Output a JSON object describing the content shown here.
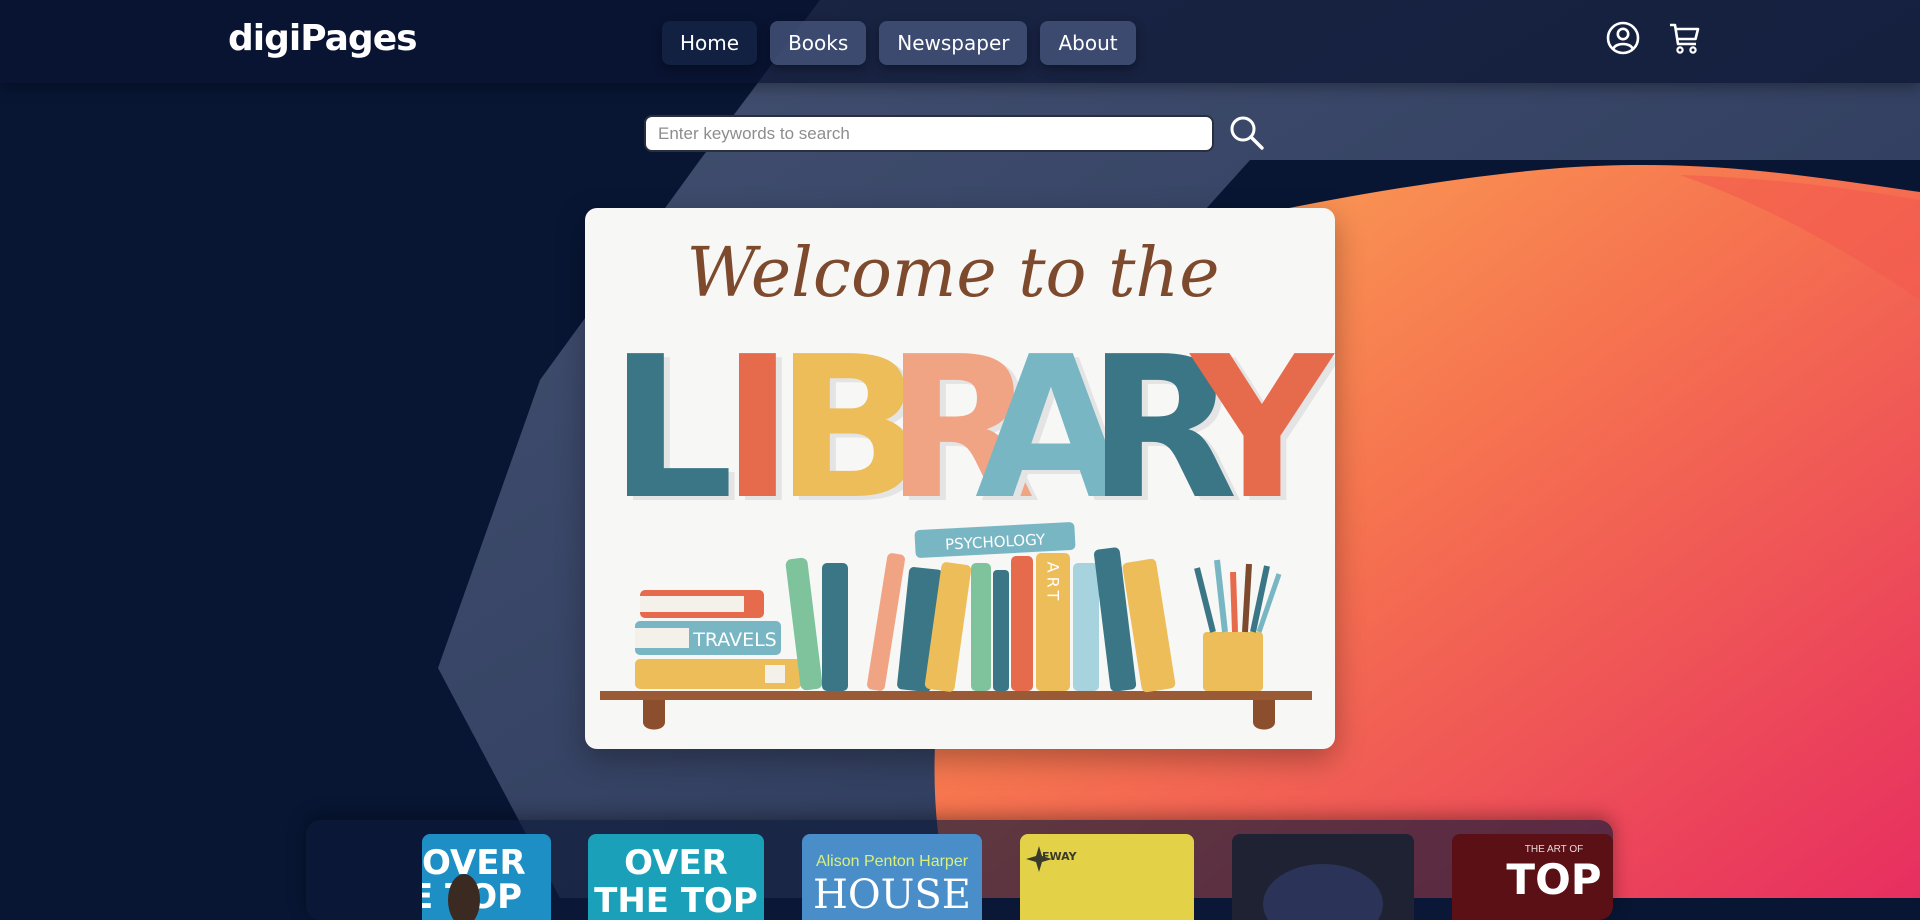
{
  "brand": {
    "name": "digiPages"
  },
  "nav": {
    "items": [
      {
        "label": "Home",
        "active": true
      },
      {
        "label": "Books",
        "active": false
      },
      {
        "label": "Newspaper",
        "active": false
      },
      {
        "label": "About",
        "active": false
      }
    ],
    "icons": [
      "user-icon",
      "cart-icon"
    ]
  },
  "search": {
    "placeholder": "Enter keywords to search",
    "value": ""
  },
  "hero": {
    "heading_script": "Welcome to the",
    "heading_letters": [
      "L",
      "I",
      "B",
      "R",
      "A",
      "R",
      "Y"
    ],
    "shelf_labels": {
      "psychology": "PSYCHOLOGY",
      "travels": "TRAVELS",
      "art": "ART"
    }
  },
  "carousel": {
    "books": [
      {
        "text_top": "OVER",
        "text_bottom": "E TOP",
        "bg": "#1d8fc4"
      },
      {
        "text_top": "OVER",
        "text_bottom": "THE TOP",
        "bg": "#1aa0b8"
      },
      {
        "text_top": "Alison Penton Harper",
        "text_bottom": "HOUSE",
        "bg": "#4a8ec9"
      },
      {
        "text_top": "FWAY",
        "text_bottom": "",
        "bg": "#e3d148"
      },
      {
        "text_top": "",
        "text_bottom": "",
        "bg": "#1f2233"
      },
      {
        "text_top": "THE ART OF",
        "text_bottom": "TOP",
        "bg": "#5b1016"
      }
    ]
  },
  "colors": {
    "navy": "#081634",
    "orange": "#f57a4a",
    "pink": "#e8315e",
    "teal": "#3b7686",
    "coral": "#e66a4c",
    "mustard": "#ecbd58",
    "peach": "#f1a484",
    "aqua": "#78b6c4"
  }
}
